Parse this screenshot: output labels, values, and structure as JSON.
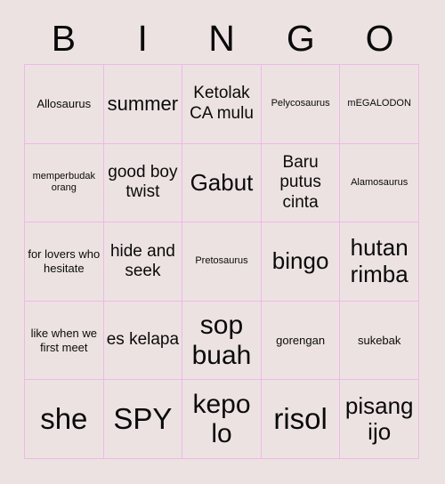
{
  "card": {
    "title": "BINGO",
    "colors": {
      "background": "#ede2e2",
      "cell_background": "#ede2e2",
      "border": "#eeb8e8",
      "text": "#0a0a0a"
    },
    "header_letters": [
      "B",
      "I",
      "N",
      "G",
      "O"
    ],
    "grid_size": "5x5",
    "cells": [
      {
        "text": "Allosaurus",
        "size": "sm"
      },
      {
        "text": "summer",
        "size": "lg"
      },
      {
        "text": "Ketolak CA mulu",
        "size": "md"
      },
      {
        "text": "Pelycosaurus",
        "size": "xs"
      },
      {
        "text": "mEGALODON",
        "size": "xs"
      },
      {
        "text": "memperbudak orang",
        "size": "xs"
      },
      {
        "text": "good boy twist",
        "size": "md"
      },
      {
        "text": "Gabut",
        "size": "xl"
      },
      {
        "text": "Baru putus cinta",
        "size": "md"
      },
      {
        "text": "Alamosaurus",
        "size": "xs"
      },
      {
        "text": "for lovers who hesitate",
        "size": "sm"
      },
      {
        "text": "hide and seek",
        "size": "md"
      },
      {
        "text": "Pretosaurus",
        "size": "xs"
      },
      {
        "text": "bingo",
        "size": "xl"
      },
      {
        "text": "hutan rimba",
        "size": "xl"
      },
      {
        "text": "like when we first meet",
        "size": "sm"
      },
      {
        "text": "es kelapa",
        "size": "md"
      },
      {
        "text": "sop buah",
        "size": "2xl"
      },
      {
        "text": "gorengan",
        "size": "sm"
      },
      {
        "text": "sukebak",
        "size": "sm"
      },
      {
        "text": "she",
        "size": "3xl"
      },
      {
        "text": "SPY",
        "size": "3xl"
      },
      {
        "text": "kepo lo",
        "size": "2xl"
      },
      {
        "text": "risol",
        "size": "3xl"
      },
      {
        "text": "pisang ijo",
        "size": "xl"
      }
    ]
  }
}
